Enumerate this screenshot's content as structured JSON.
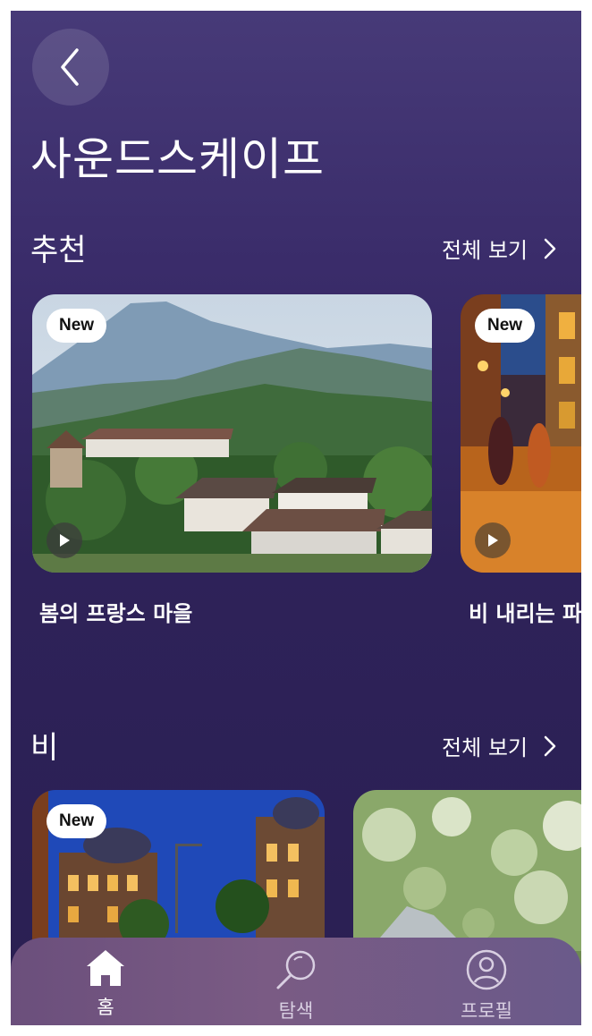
{
  "header": {
    "title": "사운드스케이프",
    "back_icon": "chevron-left-icon"
  },
  "sections": [
    {
      "title": "추천",
      "see_all": "전체 보기",
      "cards": [
        {
          "badge": "New",
          "label": "봄의 프랑스 마을"
        },
        {
          "badge": "New",
          "label": "비 내리는 파"
        }
      ]
    },
    {
      "title": "비",
      "see_all": "전체 보기",
      "cards": [
        {
          "badge": "New"
        },
        {}
      ]
    }
  ],
  "tabbar": {
    "items": [
      {
        "label": "홈",
        "icon": "home-icon",
        "active": true
      },
      {
        "label": "탐색",
        "icon": "search-icon",
        "active": false
      },
      {
        "label": "프로필",
        "icon": "profile-icon",
        "active": false
      }
    ]
  },
  "colors": {
    "bg_top": "#473a78",
    "bg_bottom": "#2a1f52",
    "tabbar": "#74578a"
  }
}
